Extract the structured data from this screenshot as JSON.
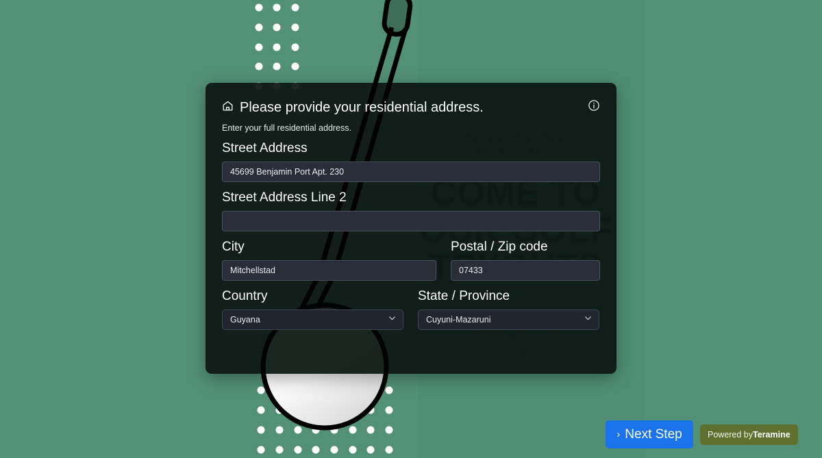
{
  "page": {
    "background_color": "#539177",
    "accent_blue": "#1a73e8",
    "badge_olive": "#5d7030"
  },
  "poster": {
    "kicker": "READY TO PROVE\nYOUR WORTH?",
    "headline": "COME TO\nOUR GOLF\nTRYOUTS",
    "subtext": "We're ready to form our junior\ngolf team!",
    "club_name": "REVLEO GOLF CLUB",
    "signup": "Sign up with Howard at 123-456-7890"
  },
  "modal": {
    "home_icon": "home-icon",
    "info_icon": "info-circle-icon",
    "title": "Please provide your residential address.",
    "subtitle": "Enter your full residential address.",
    "fields": {
      "street": {
        "label": "Street Address",
        "value": "45699 Benjamin Port Apt. 230",
        "placeholder": ""
      },
      "street2": {
        "label": "Street Address Line 2",
        "value": "",
        "placeholder": ""
      },
      "city": {
        "label": "City",
        "value": "Mitchellstad",
        "placeholder": ""
      },
      "zip": {
        "label": "Postal / Zip code",
        "value": "07433",
        "placeholder": ""
      },
      "country": {
        "label": "Country",
        "value": "Guyana",
        "chevron_icon": "chevron-down-icon"
      },
      "state": {
        "label": "State / Province",
        "value": "Cuyuni-Mazaruni",
        "chevron_icon": "chevron-down-icon"
      }
    }
  },
  "footer": {
    "next_step_caret": "›",
    "next_step_label": "Next Step",
    "powered_prefix": "Powered by",
    "powered_brand": "Teramine"
  }
}
